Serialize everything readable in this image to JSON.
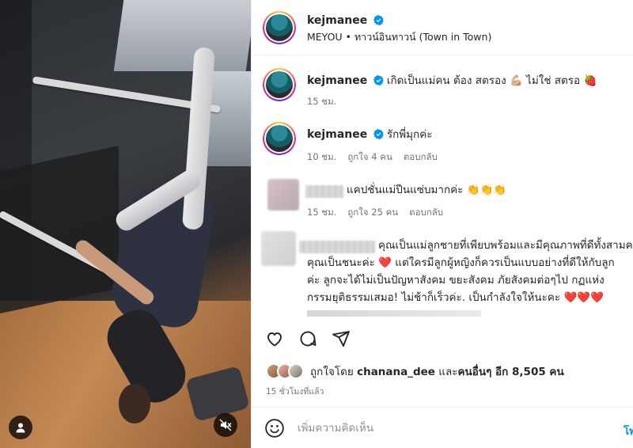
{
  "post": {
    "username": "kejmanee",
    "location": "MEYOU • ทาวน์อินทาวน์ (Town in Town)"
  },
  "caption": {
    "username": "kejmanee",
    "text": "เกิดเป็นแม่คน ต้อง สตรอง 💪🏼 ไม่ใช่ สตรอ 🍓",
    "time": "15 ชม."
  },
  "comments": [
    {
      "username": "kejmanee",
      "text": "รักพี่มุกค่ะ",
      "time": "10 ชม.",
      "likes": "ถูกใจ 4 คน",
      "reply": "ตอบกลับ"
    },
    {
      "text": "แคปชั่นแม่ปีนแซ่บมากค่ะ 👏👏👏",
      "time": "15 ชม.",
      "likes": "ถูกใจ 25 คน",
      "reply": "ตอบกลับ"
    },
    {
      "line1": "คุณเป็นแม่ลูกชายที่เพียบพร้อมและมีคุณภาพที่ดีทั้งสามคน",
      "line2": "คุณเป็นชนะค่ะ ❤️ แต่ใครมีลูกผู้หญิงก็ควรเป็นแบบอย่างที่ดีให้กับลูก",
      "line3": "ค่ะ ลูกจะได้ไม่เป็นปัญหาสังคม ขยะสังคม ภัยสังคมต่อๆไป กฏแห่ง",
      "line4": "กรรมยุติธรรมเสมอ! ไม่ช้าก็เร็วค่ะ. เป็นกำลังใจให้นะคะ ❤️❤️❤️"
    }
  ],
  "likes": {
    "prefix": "ถูกใจโดย ",
    "user": "chanana_dee",
    "middle": " และ",
    "others": "คนอื่นๆ อีก 8,505 คน"
  },
  "posted_time": "15 ชั่วโมงที่แล้ว",
  "add_comment": {
    "placeholder": "เพิ่มความคิดเห็น",
    "post_label": "โพ"
  },
  "colors": {
    "text": "#262626",
    "muted": "#737373",
    "verified": "#0095f6",
    "heart": "#ed4956"
  },
  "icons": [
    "verified-badge-icon",
    "heart-icon",
    "comment-icon",
    "share-icon",
    "emoji-icon",
    "user-tag-icon",
    "mute-icon"
  ]
}
